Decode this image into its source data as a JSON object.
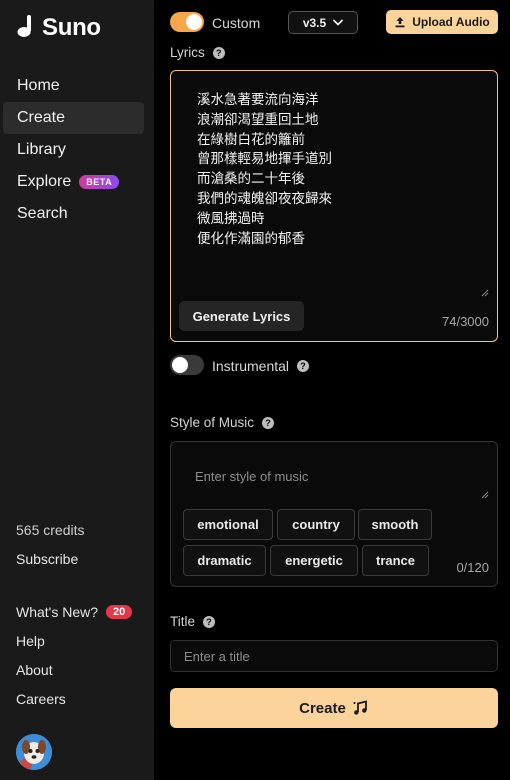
{
  "app": {
    "name": "Suno"
  },
  "sidebar": {
    "items": [
      {
        "label": "Home"
      },
      {
        "label": "Create",
        "active": true
      },
      {
        "label": "Library"
      },
      {
        "label": "Explore",
        "badge": "BETA"
      },
      {
        "label": "Search"
      }
    ],
    "credits": "565 credits",
    "subscribe": "Subscribe",
    "whats_new": {
      "label": "What's New?",
      "count": "20"
    },
    "help": "Help",
    "about": "About",
    "careers": "Careers"
  },
  "form": {
    "custom": {
      "label": "Custom",
      "on": true
    },
    "version": "v3.5",
    "upload_audio": "Upload Audio",
    "lyrics": {
      "label": "Lyrics",
      "value": "溪水急著要流向海洋\n浪潮卻渴望重回土地\n在綠樹白花的籬前\n曾那樣輕易地揮手道別\n而滄桑的二十年後\n我們的魂魄卻夜夜歸來\n微風拂過時\n便化作滿園的郁香",
      "generate_button": "Generate Lyrics",
      "counter": "74/3000"
    },
    "instrumental": {
      "label": "Instrumental",
      "on": false
    },
    "style": {
      "label": "Style of Music",
      "placeholder": "Enter style of music",
      "tags": [
        "emotional",
        "country",
        "smooth",
        "dramatic",
        "energetic",
        "trance"
      ],
      "counter": "0/120"
    },
    "title": {
      "label": "Title",
      "placeholder": "Enter a title"
    },
    "create_button": "Create"
  },
  "colors": {
    "accent": "#fcd39a",
    "toggle_on": "#f7a64a",
    "sidebar_bg": "#1a1a1a",
    "badge_red": "#e6364a"
  },
  "icons": [
    "suno-logo-icon",
    "chevron-down-icon",
    "upload-icon",
    "help-icon",
    "music-note-icon",
    "resize-handle-icon"
  ]
}
